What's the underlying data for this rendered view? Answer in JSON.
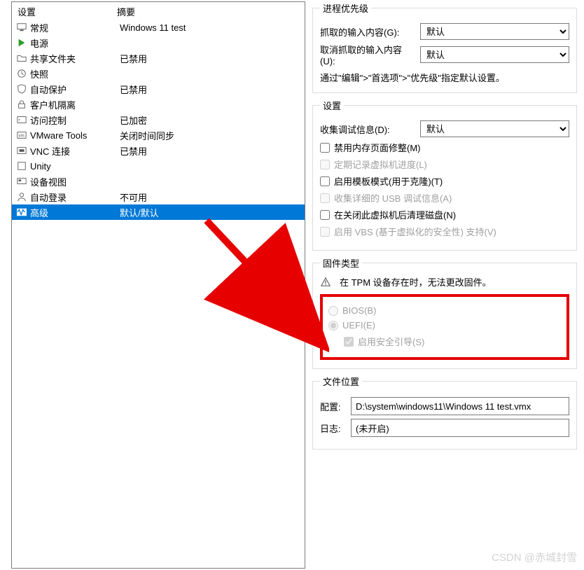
{
  "left": {
    "header_col1": "设置",
    "header_col2": "摘要",
    "rows": [
      {
        "icon": "monitor",
        "label": "常规",
        "value": "Windows 11 test"
      },
      {
        "icon": "play",
        "label": "电源",
        "value": ""
      },
      {
        "icon": "folder",
        "label": "共享文件夹",
        "value": "已禁用"
      },
      {
        "icon": "clock",
        "label": "快照",
        "value": ""
      },
      {
        "icon": "shield",
        "label": "自动保护",
        "value": "已禁用"
      },
      {
        "icon": "lock",
        "label": "客户机隔离",
        "value": ""
      },
      {
        "icon": "key",
        "label": "访问控制",
        "value": "已加密"
      },
      {
        "icon": "vm",
        "label": "VMware Tools",
        "value": "关闭时间同步"
      },
      {
        "icon": "vnc",
        "label": "VNC 连接",
        "value": "已禁用"
      },
      {
        "icon": "unity",
        "label": "Unity",
        "value": ""
      },
      {
        "icon": "device",
        "label": "设备视图",
        "value": ""
      },
      {
        "icon": "user",
        "label": "自动登录",
        "value": "不可用"
      },
      {
        "icon": "wave",
        "label": "高级",
        "value": "默认/默认",
        "selected": true
      }
    ]
  },
  "priority": {
    "legend": "进程优先级",
    "grab_label": "抓取的输入内容(G):",
    "ungrab_label": "取消抓取的输入内容(U):",
    "default_option": "默认",
    "hint": "通过\"编辑\">\"首选项\">\"优先级\"指定默认设置。"
  },
  "settings": {
    "legend": "设置",
    "debug_label": "收集调试信息(D):",
    "debug_option": "默认",
    "cb_mem": "禁用内存页面修整(M)",
    "cb_log": "定期记录虚拟机进度(L)",
    "cb_template": "启用模板模式(用于克隆)(T)",
    "cb_usb": "收集详细的 USB 调试信息(A)",
    "cb_clean": "在关闭此虚拟机后清理磁盘(N)",
    "cb_vbs": "启用 VBS (基于虚拟化的安全性) 支持(V)"
  },
  "firmware": {
    "legend": "固件类型",
    "warn": "在 TPM 设备存在时，无法更改固件。",
    "bios": "BIOS(B)",
    "uefi": "UEFI(E)",
    "secure_boot": "启用安全引导(S)"
  },
  "file": {
    "legend": "文件位置",
    "config_label": "配置:",
    "config_value": "D:\\system\\windows11\\Windows 11 test.vmx",
    "log_label": "日志:",
    "log_value": "(未开启)"
  },
  "watermark": "CSDN @赤城封雪"
}
